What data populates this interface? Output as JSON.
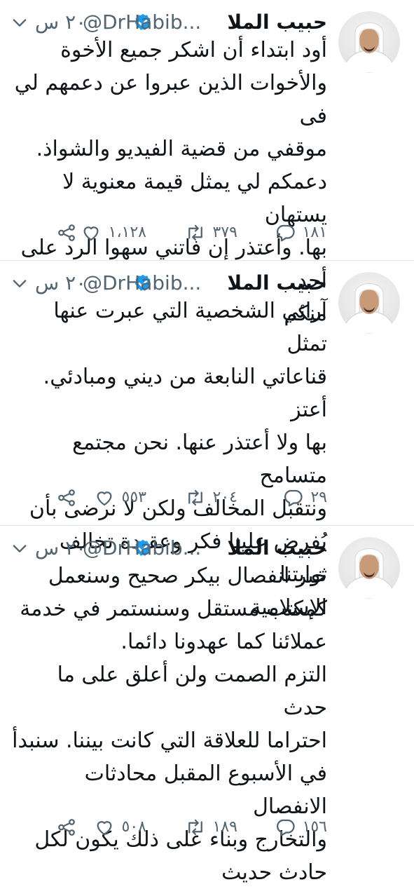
{
  "tweets": [
    {
      "name": "حبيب الملا",
      "handle": "@DrHabib...",
      "time": "٢٠ س",
      "text": "أود ابتداء أن اشكر جميع الأخوة\nوالأخوات الذين عبروا عن دعمهم لي فى\nموقفي من قضية الفيديو والشواذ.\nدعمكم لي يمثل قيمة معنوية لا يستهان\nبها. وأعتذر إن فاتني سهوا الرد على أحد\nمنكم",
      "replies": "١٨١",
      "retweets": "٣٧٩",
      "likes": "١،١٢٨"
    },
    {
      "name": "حبيب الملا",
      "handle": "@DrHabib...",
      "time": "٢٠ س",
      "text": "آرائي الشخصية التي عبرت عنها تمثل\nقناعاتي النابعة من ديني ومبادئي. أعتز\nبها ولا أعتذر عنها. نحن مجتمع متسامح\nونتقبل المخالف ولكن لا نرضى بأن\nيُفرض علينا فكر وعقيدة تخالف ثوابتنا\nالإسلامية",
      "replies": "٢٩",
      "retweets": "٢٠٤",
      "likes": "٥٥٣"
    },
    {
      "name": "حبيب الملا",
      "handle": "@DrHabib...",
      "time": "٢٠ س",
      "text": "خبر انفصال بيكر صحيح وسنعمل\nكمكتب مستقل وسنستمر في خدمة\nعملائنا كما عهدونا دائما.\nالتزم الصمت ولن أعلق على ما حدث\nاحتراما للعلاقة التي كانت بيننا. سنبدأ\nفي الأسبوع المقبل محادثات الانفصال\nوالتخارج وبناء على ذلك يكون لكل\nحادث حديث",
      "replies": "١٥٦",
      "retweets": "١٨٩",
      "likes": "٥٠٨"
    }
  ],
  "icons": {
    "verified": "verified-badge-icon",
    "caret": "chevron-down-icon",
    "reply": "reply-icon",
    "retweet": "retweet-icon",
    "like": "heart-icon",
    "share": "share-icon"
  },
  "colors": {
    "verified": "#1d9bf0",
    "secondary_text": "#536471",
    "separator": "#e1e8ed"
  }
}
